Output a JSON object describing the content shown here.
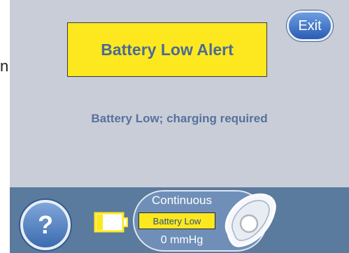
{
  "edge_text": "n",
  "alert": {
    "title": "Battery Low Alert",
    "message": "Battery Low; charging required"
  },
  "exit_button": {
    "label": "Exit"
  },
  "footer": {
    "help_label": "?",
    "mode": "Continuous",
    "battery_badge": "Battery Low",
    "pressure": "0 mmHg",
    "battery_level": 0.25
  },
  "colors": {
    "screen_background": "#c9cdd8",
    "alert_yellow": "#fde81f",
    "text_blue": "#4b6b96",
    "footer_bar": "#5a7a9e",
    "button_blue": "#3b6bb0"
  },
  "icons": [
    "help-icon",
    "battery-icon",
    "status-blob-icon"
  ]
}
